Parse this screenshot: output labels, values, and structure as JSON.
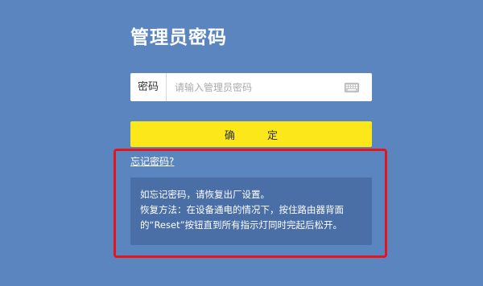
{
  "page": {
    "title": "管理员密码"
  },
  "password": {
    "label": "密码",
    "placeholder": "请输入管理员密码",
    "value": "",
    "keyboard_icon": "keyboard-icon"
  },
  "confirm_button": {
    "label": "确 定"
  },
  "forgot": {
    "link_text": "忘记密码?",
    "tip_line_1": "如忘记密码，请恢复出厂设置。",
    "tip_line_2": "恢复方法：在设备通电的情况下，按住路由器背面",
    "tip_line_3": "的“Reset”按钮直到所有指示灯同时完起后松开。"
  },
  "colors": {
    "background": "#5b85bf",
    "button": "#fce81a",
    "tip_background": "#4a6ea6",
    "highlight": "#e8141b"
  }
}
